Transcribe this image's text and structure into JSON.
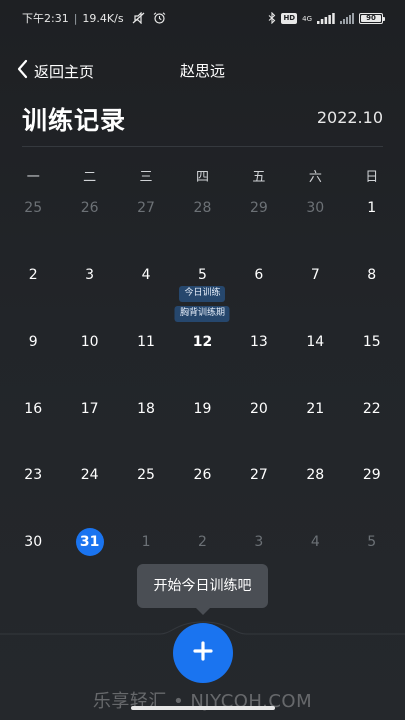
{
  "status_bar": {
    "time": "下午2:31",
    "network_speed": "19.4K/s",
    "net_type": "4G",
    "battery": "90"
  },
  "nav": {
    "back_label": "返回主页",
    "title": "赵思远"
  },
  "page": {
    "title": "训练记录",
    "month": "2022.10"
  },
  "calendar": {
    "weekdays": [
      "一",
      "二",
      "三",
      "四",
      "五",
      "六",
      "日"
    ],
    "weeks": [
      [
        {
          "day": "25",
          "muted": true
        },
        {
          "day": "26",
          "muted": true
        },
        {
          "day": "27",
          "muted": true
        },
        {
          "day": "28",
          "muted": true
        },
        {
          "day": "29",
          "muted": true
        },
        {
          "day": "30",
          "muted": true
        },
        {
          "day": "1"
        }
      ],
      [
        {
          "day": "2"
        },
        {
          "day": "3"
        },
        {
          "day": "4"
        },
        {
          "day": "5",
          "tags": [
            "今日训练",
            "胸背训练期"
          ]
        },
        {
          "day": "6"
        },
        {
          "day": "7"
        },
        {
          "day": "8"
        }
      ],
      [
        {
          "day": "9"
        },
        {
          "day": "10"
        },
        {
          "day": "11"
        },
        {
          "day": "12",
          "bold": true
        },
        {
          "day": "13"
        },
        {
          "day": "14"
        },
        {
          "day": "15"
        }
      ],
      [
        {
          "day": "16"
        },
        {
          "day": "17"
        },
        {
          "day": "18"
        },
        {
          "day": "19"
        },
        {
          "day": "20"
        },
        {
          "day": "21"
        },
        {
          "day": "22"
        }
      ],
      [
        {
          "day": "23"
        },
        {
          "day": "24"
        },
        {
          "day": "25"
        },
        {
          "day": "26"
        },
        {
          "day": "27"
        },
        {
          "day": "28"
        },
        {
          "day": "29"
        }
      ],
      [
        {
          "day": "30"
        },
        {
          "day": "31",
          "selected": true
        },
        {
          "day": "1",
          "muted": true
        },
        {
          "day": "2",
          "muted": true
        },
        {
          "day": "3",
          "muted": true
        },
        {
          "day": "4",
          "muted": true
        },
        {
          "day": "5",
          "muted": true
        }
      ]
    ]
  },
  "tooltip": {
    "text": "开始今日训练吧"
  },
  "watermark": "乐享轻汇 • NJYCQH.COM",
  "colors": {
    "accent": "#1a74f0",
    "tag_bg": "#26476d",
    "tooltip_bg": "#4a4e54",
    "muted_text": "#6c7176"
  },
  "icons": {
    "back": "chevron-left-icon",
    "add": "plus-icon",
    "bluetooth": "bluetooth-icon",
    "alarm": "alarm-clock-icon",
    "signal": "signal-bars-icon",
    "battery": "battery-icon"
  }
}
